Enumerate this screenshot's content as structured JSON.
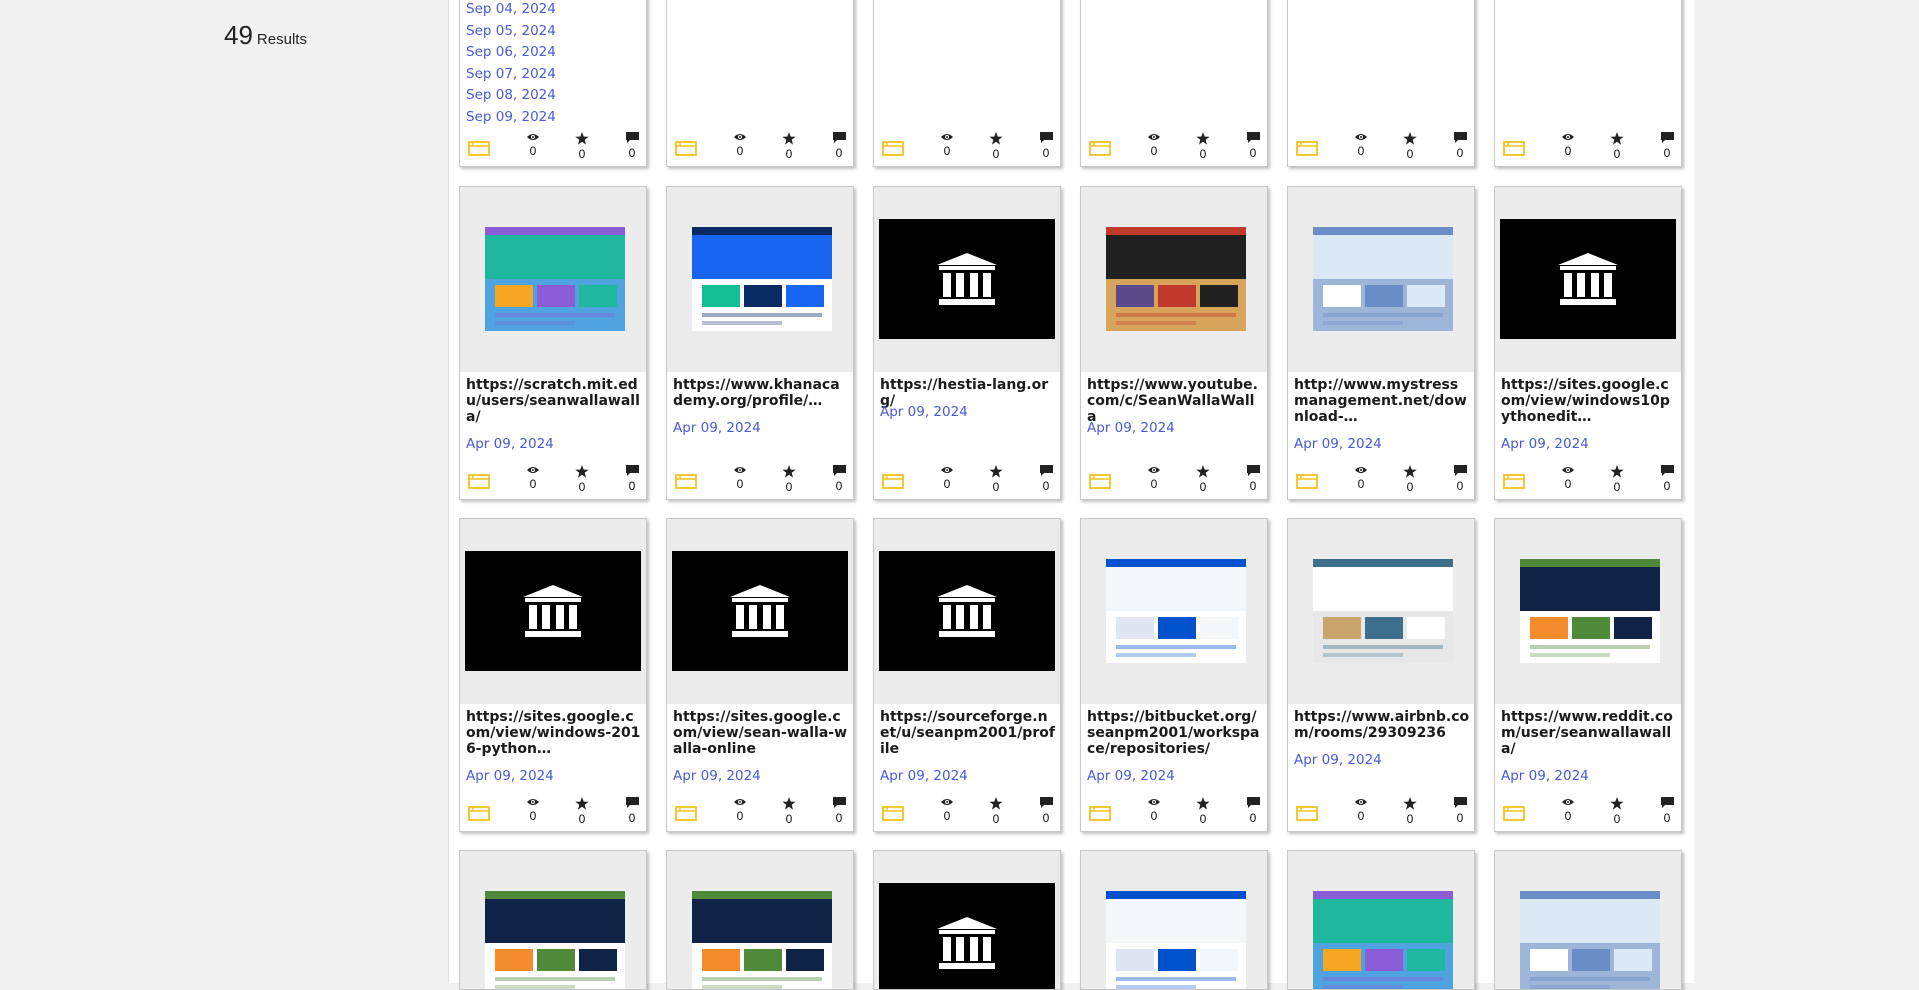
{
  "sidebar": {
    "results_count": "49",
    "results_label": "Results"
  },
  "top_row": {
    "dates": [
      "Sep 04, 2024",
      "Sep 05, 2024",
      "Sep 06, 2024",
      "Sep 07, 2024",
      "Sep 08, 2024",
      "Sep 09, 2024"
    ],
    "stats": {
      "views": "0",
      "stars": "0",
      "comments": "0"
    }
  },
  "cards": [
    {
      "url": "https://scratch.mit.edu/users/seanwallawalla/",
      "date": "Apr 09, 2024",
      "thumb": "screenshot-scratch",
      "views": "0",
      "stars": "0",
      "comments": "0"
    },
    {
      "url": "https://www.khanacademy.org/profile/…",
      "date": "Apr 09, 2024",
      "thumb": "screenshot-khanacademy",
      "views": "0",
      "stars": "0",
      "comments": "0"
    },
    {
      "url": "https://hestia-lang.org/",
      "date": "Apr 09, 2024",
      "thumb": "archive-icon",
      "views": "0",
      "stars": "0",
      "comments": "0"
    },
    {
      "url": "https://www.youtube.com/c/SeanWallaWalla",
      "date": "Apr 09, 2024",
      "thumb": "screenshot-youtube",
      "views": "0",
      "stars": "0",
      "comments": "0"
    },
    {
      "url": "http://www.mystressmanagement.net/download-…",
      "date": "Apr 09, 2024",
      "thumb": "screenshot-mystressmanagement",
      "views": "0",
      "stars": "0",
      "comments": "0"
    },
    {
      "url": "https://sites.google.com/view/windows10pythonedit…",
      "date": "Apr 09, 2024",
      "thumb": "archive-icon",
      "views": "0",
      "stars": "0",
      "comments": "0"
    },
    {
      "url": "https://sites.google.com/view/windows-2016-python…",
      "date": "Apr 09, 2024",
      "thumb": "archive-icon",
      "views": "0",
      "stars": "0",
      "comments": "0"
    },
    {
      "url": "https://sites.google.com/view/sean-walla-walla-online",
      "date": "Apr 09, 2024",
      "thumb": "archive-icon",
      "views": "0",
      "stars": "0",
      "comments": "0"
    },
    {
      "url": "https://sourceforge.net/u/seanpm2001/profile",
      "date": "Apr 09, 2024",
      "thumb": "archive-icon",
      "views": "0",
      "stars": "0",
      "comments": "0"
    },
    {
      "url": "https://bitbucket.org/seanpm2001/workspace/repositories/",
      "date": "Apr 09, 2024",
      "thumb": "screenshot-bitbucket",
      "views": "0",
      "stars": "0",
      "comments": "0"
    },
    {
      "url": "https://www.airbnb.com/rooms/29309236",
      "date": "Apr 09, 2024",
      "thumb": "screenshot-airbnb",
      "views": "0",
      "stars": "0",
      "comments": "0"
    },
    {
      "url": "https://www.reddit.com/user/seanwallawalla/",
      "date": "Apr 09, 2024",
      "thumb": "screenshot-reddit",
      "views": "0",
      "stars": "0",
      "comments": "0"
    }
  ],
  "colors": {
    "date_link": "#4a5ad8",
    "web_icon": "#f2c21b",
    "background": "#f1f1f1"
  }
}
